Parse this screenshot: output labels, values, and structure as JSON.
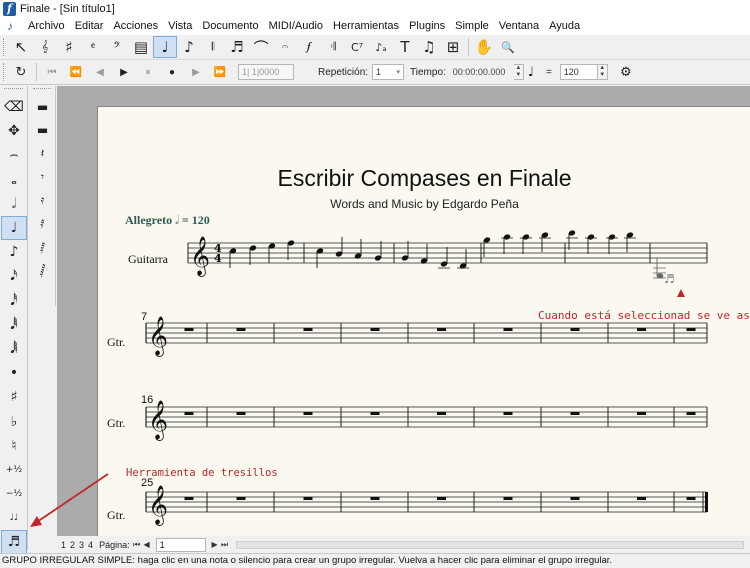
{
  "window": {
    "title": "Finale - [Sin título1]"
  },
  "menu": [
    "Archivo",
    "Editar",
    "Acciones",
    "Vista",
    "Documento",
    "MIDI/Audio",
    "Herramientas",
    "Plugins",
    "Simple",
    "Ventana",
    "Ayuda"
  ],
  "toolbar1": {
    "tools": [
      {
        "name": "selection-tool",
        "glyph": "↖"
      },
      {
        "name": "staff-tool",
        "glyph": "𝄞"
      },
      {
        "name": "key-signature-tool",
        "glyph": "♯"
      },
      {
        "name": "time-signature-tool",
        "glyph": "𝄴"
      },
      {
        "name": "clef-tool",
        "glyph": "𝄢"
      },
      {
        "name": "measure-tool",
        "glyph": "▤"
      },
      {
        "name": "simple-entry-tool",
        "glyph": "♩",
        "active": true
      },
      {
        "name": "speedy-entry-tool",
        "glyph": "♪"
      },
      {
        "name": "hyperscribe-tool",
        "glyph": "𝄃"
      },
      {
        "name": "tuplet-tool",
        "glyph": "♬"
      },
      {
        "name": "smart-shape-tool",
        "glyph": "⌒"
      },
      {
        "name": "articulation-tool",
        "glyph": "𝄐"
      },
      {
        "name": "expression-tool",
        "glyph": "𝆑"
      },
      {
        "name": "repeat-tool",
        "glyph": "𝄇"
      },
      {
        "name": "chord-tool",
        "glyph": "C⁷"
      },
      {
        "name": "lyrics-tool",
        "glyph": "♪ₐ"
      },
      {
        "name": "text-tool",
        "glyph": "T"
      },
      {
        "name": "mirror-tool",
        "glyph": "♫"
      },
      {
        "name": "special-tools",
        "glyph": "⊞"
      },
      {
        "name": "hand-grabber-tool",
        "glyph": "✋"
      },
      {
        "name": "zoom-tool",
        "glyph": "🔍"
      }
    ]
  },
  "toolbar2": {
    "counter": "1| 1|0000",
    "repeat_label": "Repetición:",
    "repeat_value": "1",
    "time_label": "Tiempo:",
    "time_value": "00:00:00.000",
    "tempo_eq": "=",
    "tempo_value": "120"
  },
  "palette_left": [
    {
      "name": "eraser-tool",
      "glyph": "⌫"
    },
    {
      "name": "half-step-tool",
      "glyph": "✥"
    },
    {
      "name": "tie-tool",
      "glyph": "⌢"
    },
    {
      "name": "whole-note-tool",
      "glyph": "𝅝"
    },
    {
      "name": "half-note-tool",
      "glyph": "𝅗𝅥"
    },
    {
      "name": "quarter-note-tool",
      "glyph": "♩",
      "active": true
    },
    {
      "name": "eighth-note-tool",
      "glyph": "♪"
    },
    {
      "name": "sixteenth-note-tool",
      "glyph": "𝅘𝅥𝅯"
    },
    {
      "name": "thirty-second-note-tool",
      "glyph": "𝅘𝅥𝅰"
    },
    {
      "name": "sixty-fourth-note-tool",
      "glyph": "𝅘𝅥𝅱"
    },
    {
      "name": "128th-note-tool",
      "glyph": "𝅘𝅥𝅲"
    },
    {
      "name": "dot-tool",
      "glyph": "•"
    },
    {
      "name": "sharp-tool",
      "glyph": "♯"
    },
    {
      "name": "flat-tool",
      "glyph": "♭"
    },
    {
      "name": "natural-tool",
      "glyph": "♮"
    },
    {
      "name": "half-step-up-tool",
      "glyph": "+½"
    },
    {
      "name": "half-step-down-tool",
      "glyph": "−½"
    },
    {
      "name": "grace-note-tool",
      "glyph": "♩♩"
    },
    {
      "name": "tuplet-palette-tool",
      "glyph": "♬",
      "active": true
    }
  ],
  "palette_right": [
    {
      "name": "whole-rest-tool",
      "glyph": "▬"
    },
    {
      "name": "half-rest-tool",
      "glyph": "▬"
    },
    {
      "name": "quarter-rest-tool",
      "glyph": "𝄽"
    },
    {
      "name": "eighth-rest-tool",
      "glyph": "𝄾"
    },
    {
      "name": "sixteenth-rest-tool",
      "glyph": "𝄿"
    },
    {
      "name": "thirty-second-rest-tool",
      "glyph": "𝅀"
    },
    {
      "name": "sixty-fourth-rest-tool",
      "glyph": "𝅁"
    },
    {
      "name": "128th-rest-tool",
      "glyph": "𝅂"
    }
  ],
  "score": {
    "title": "Escribir Compases en Finale",
    "subtitle": "Words and Music by Edgardo Peña",
    "tempo_text": "Allegreto",
    "tempo_note": "𝅗𝅥",
    "tempo_value": "= 120",
    "instrument_full": "Guitarra",
    "instrument_short": "Gtr.",
    "time_signature_top": "4",
    "time_signature_bottom": "4",
    "measure_numbers": [
      "7",
      "16",
      "25"
    ]
  },
  "annotations": {
    "selected_note": "Cuando está seleccionad se ve asi",
    "tuplet_tool": "Herramienta de tresillos"
  },
  "nav": {
    "pages": [
      "1",
      "2",
      "3",
      "4"
    ],
    "page_label": "Página:",
    "page_value": "1"
  },
  "status": "GRUPO IRREGULAR SIMPLE: haga clic en una nota o silencio para crear un grupo irregular. Vuelva a hacer clic para eliminar el grupo irregular.",
  "colors": {
    "accent": "#c0262b",
    "tempo": "#2f5a57",
    "active_tool": "#cfe0f4"
  }
}
